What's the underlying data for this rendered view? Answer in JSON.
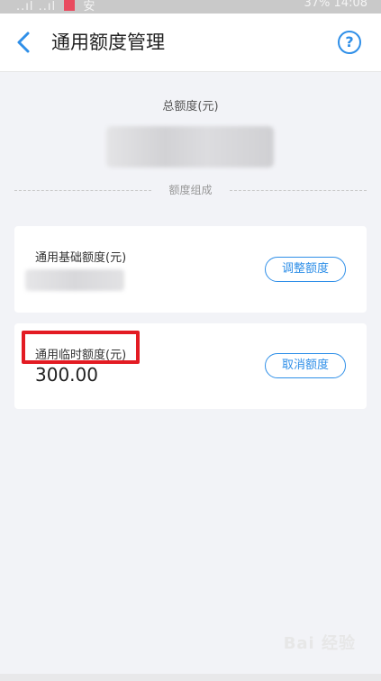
{
  "status_bar": {
    "left_text": "..ıl ..ıl",
    "app_badge_text": "安",
    "right_text": "37% 14:08"
  },
  "nav": {
    "title": "通用额度管理",
    "help_glyph": "?"
  },
  "summary": {
    "total_label": "总额度(元)",
    "composition_label": "额度组成"
  },
  "base_quota": {
    "label": "通用基础额度(元)",
    "button_label": "调整额度"
  },
  "temp_quota": {
    "label": "通用临时额度(元)",
    "value": "300.00",
    "button_label": "取消额度"
  },
  "watermark": {
    "text": "Bai 经验"
  },
  "colors": {
    "accent": "#2f8fe8",
    "highlight": "#e31b23",
    "background": "#f2f3f7"
  }
}
